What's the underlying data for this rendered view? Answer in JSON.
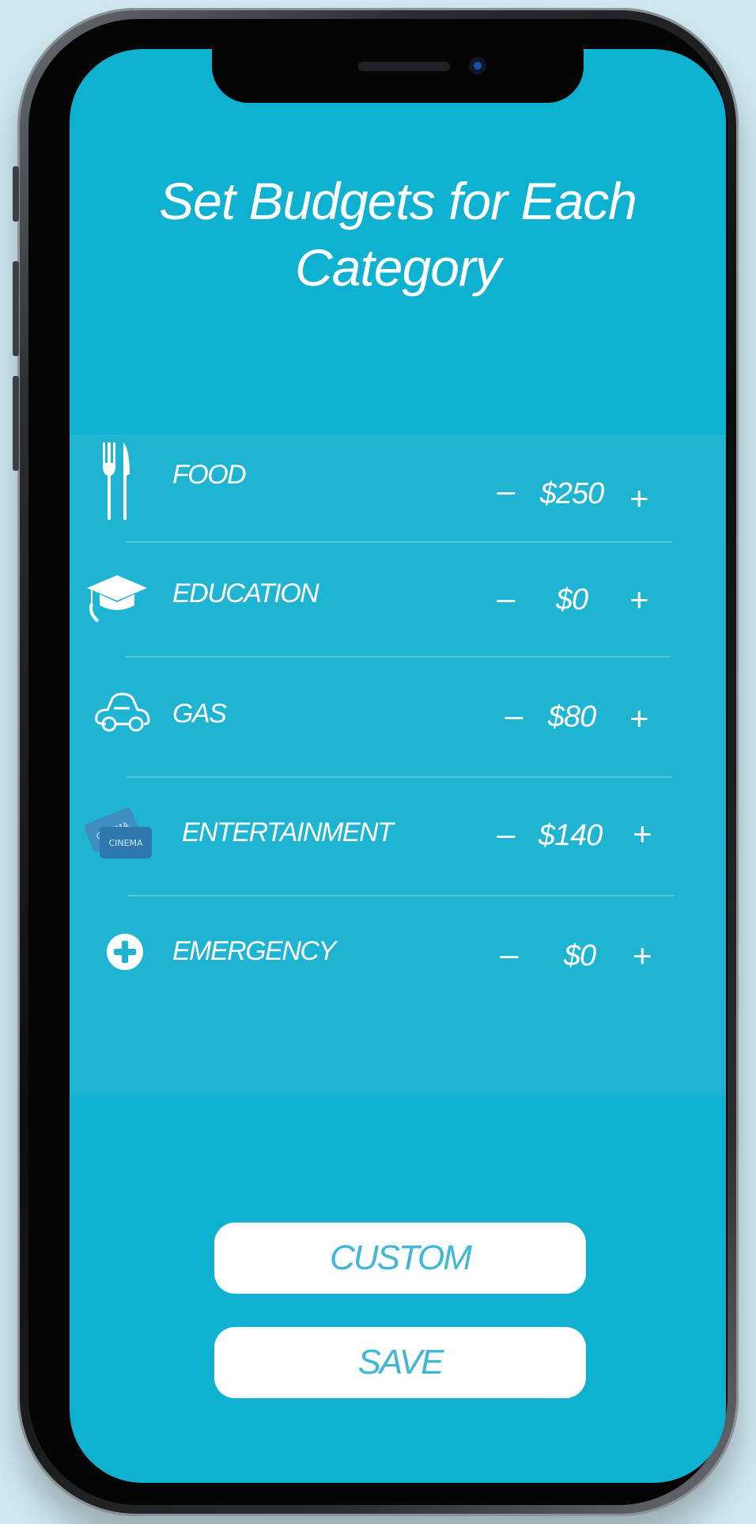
{
  "screen": {
    "title": "Set Budgets for Each Category",
    "title_line1": "Set Budgets for Each",
    "title_line2": "Category"
  },
  "categories": [
    {
      "label": "FOOD",
      "amount": "$250",
      "icon": "fork-knife-icon"
    },
    {
      "label": "EDUCATION",
      "amount": "$0",
      "icon": "graduation-cap-icon"
    },
    {
      "label": "GAS",
      "amount": "$80",
      "icon": "car-icon"
    },
    {
      "label": "ENTERTAINMENT",
      "amount": "$140",
      "icon": "cinema-ticket-icon"
    },
    {
      "label": "EMERGENCY",
      "amount": "$0",
      "icon": "plus-circle-icon"
    }
  ],
  "controls": {
    "minus": "–",
    "plus": "+"
  },
  "buttons": {
    "custom": "CUSTOM",
    "save": "SAVE"
  },
  "colors": {
    "screen_bg": "#0fb1d0",
    "panel_bg": "#20b4d3",
    "button_text": "#3fb7d6"
  }
}
